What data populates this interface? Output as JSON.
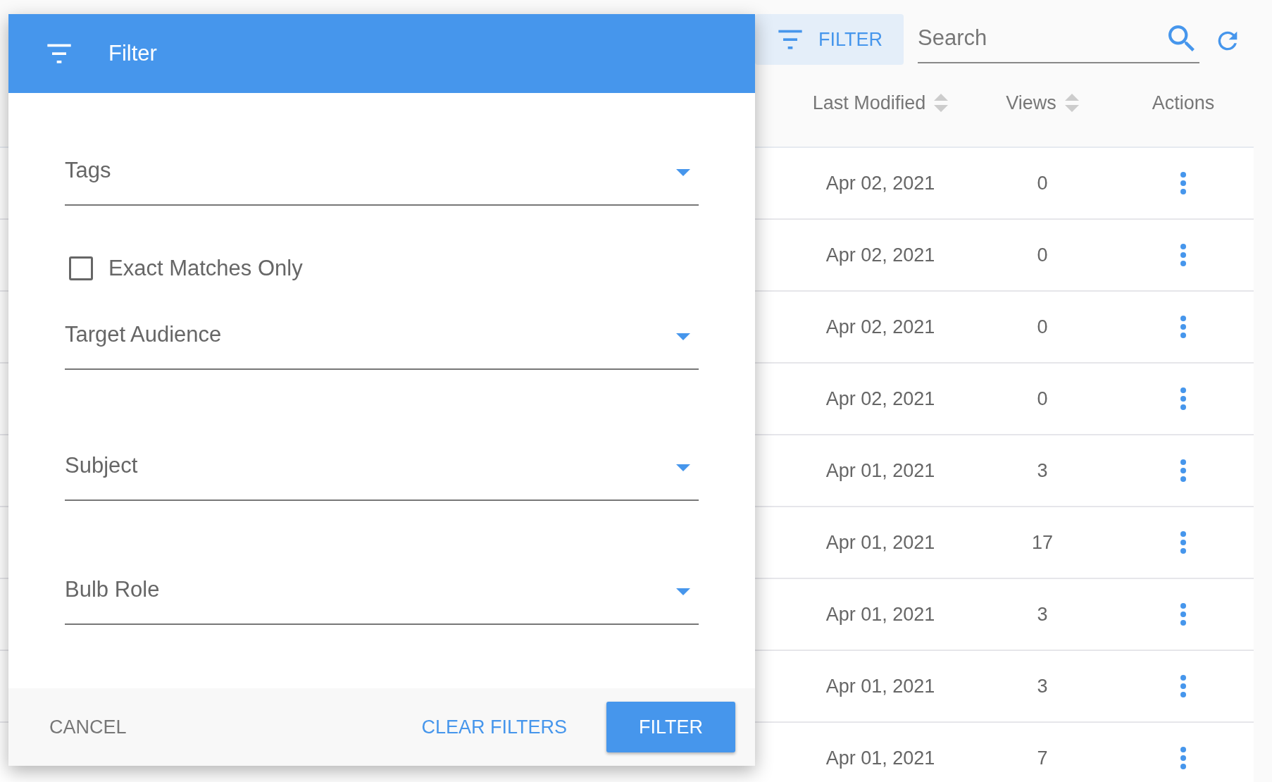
{
  "toolbar": {
    "filter_button": "FILTER",
    "search": {
      "placeholder": "Search"
    }
  },
  "table": {
    "columns": [
      {
        "label": "Last Modified",
        "sortable": true
      },
      {
        "label": "Views",
        "sortable": true
      },
      {
        "label": "Actions",
        "sortable": false
      }
    ],
    "rows": [
      {
        "last_modified": "Apr 02, 2021",
        "views": "0"
      },
      {
        "last_modified": "Apr 02, 2021",
        "views": "0"
      },
      {
        "last_modified": "Apr 02, 2021",
        "views": "0"
      },
      {
        "last_modified": "Apr 02, 2021",
        "views": "0"
      },
      {
        "last_modified": "Apr 01, 2021",
        "views": "3"
      },
      {
        "last_modified": "Apr 01, 2021",
        "views": "17"
      },
      {
        "last_modified": "Apr 01, 2021",
        "views": "3"
      },
      {
        "last_modified": "Apr 01, 2021",
        "views": "3"
      },
      {
        "last_modified": "Apr 01, 2021",
        "views": "7"
      }
    ]
  },
  "dialog": {
    "title": "Filter",
    "fields": [
      {
        "kind": "select",
        "label": "Tags"
      },
      {
        "kind": "checkbox",
        "label": "Exact Matches Only",
        "checked": false
      },
      {
        "kind": "select",
        "label": "Target Audience"
      },
      {
        "kind": "select",
        "label": "Subject"
      },
      {
        "kind": "select",
        "label": "Bulb Role"
      }
    ],
    "buttons": [
      {
        "label": "CANCEL",
        "kind": "plain"
      },
      {
        "label": "CLEAR FILTERS",
        "kind": "link"
      },
      {
        "label": "FILTER",
        "kind": "primary"
      }
    ]
  }
}
